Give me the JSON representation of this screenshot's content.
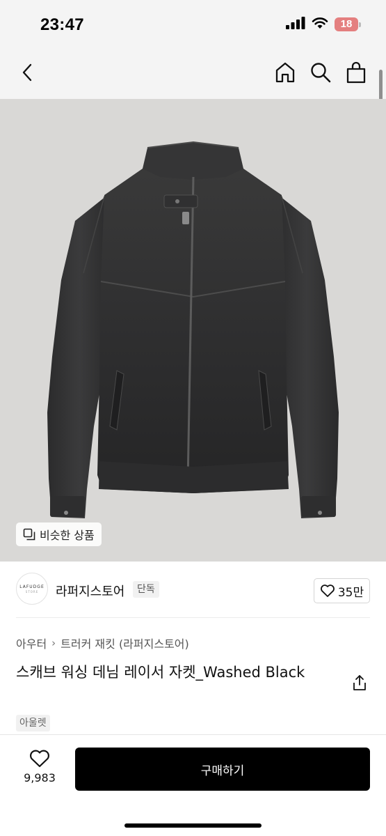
{
  "status_bar": {
    "time": "23:47",
    "battery_level": "18",
    "icons": [
      "signal-icon",
      "wifi-icon",
      "battery-icon"
    ]
  },
  "nav": {
    "icons": [
      "back-icon",
      "home-icon",
      "search-icon",
      "shopping-bag-icon"
    ]
  },
  "product_image": {
    "similar_label": "비슷한 상품"
  },
  "store": {
    "logo_text": "LAFUDGE",
    "logo_subtext": "STORE",
    "name": "라퍼지스토어",
    "badge": "단독",
    "likes": "35만"
  },
  "product": {
    "breadcrumb": [
      "아우터",
      "트러커 재킷 (라퍼지스토어)"
    ],
    "title": "스캐브 워싱 데님 레이서 자켓_Washed Black",
    "tag": "아울렛"
  },
  "bottom_bar": {
    "wish_count": "9,983",
    "buy_label": "구매하기"
  },
  "colors": {
    "header_bg": "#f4f4f4",
    "image_bg": "#d9d8d6",
    "buy_button": "#000000",
    "battery_low": "#e06a6a"
  }
}
